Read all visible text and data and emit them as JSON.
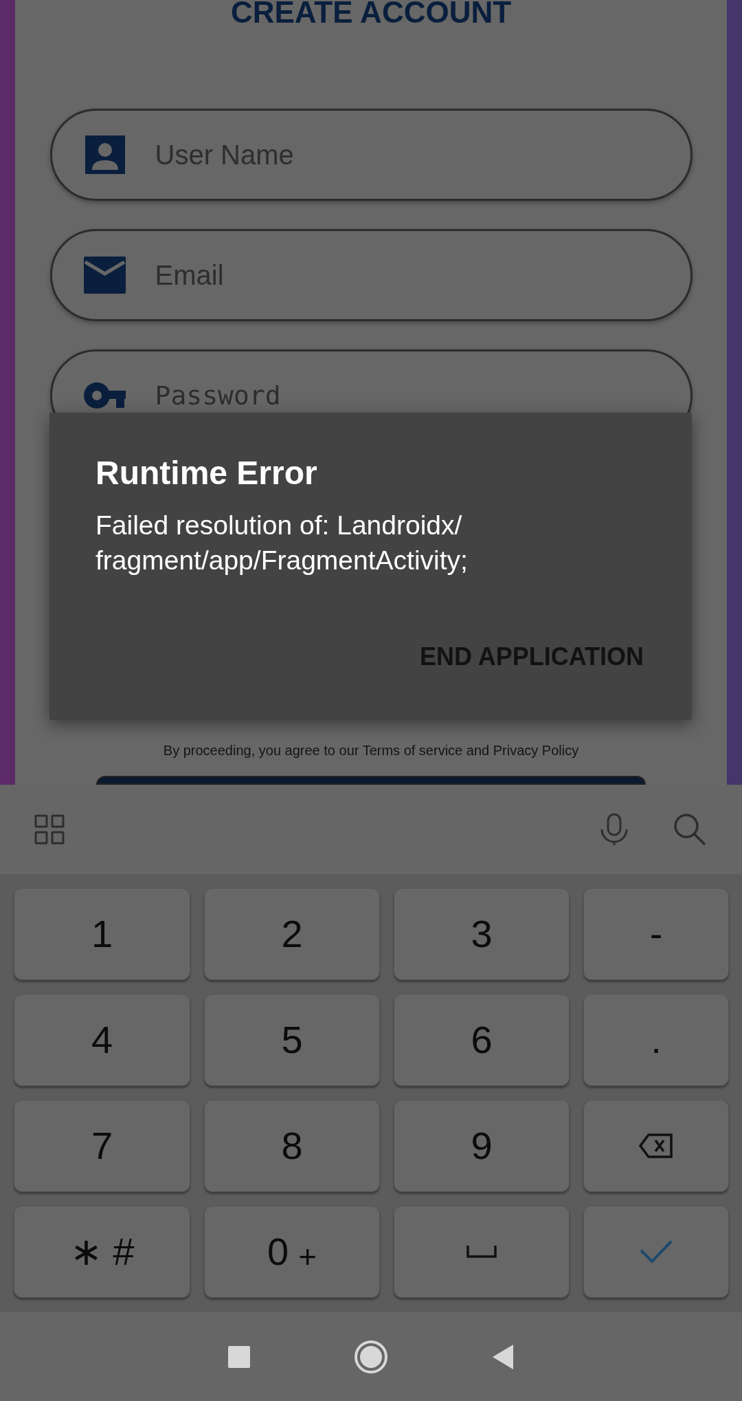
{
  "title": "CREATE ACCOUNT",
  "fields": [
    {
      "kind": "user",
      "placeholder": "User Name"
    },
    {
      "kind": "email",
      "placeholder": "Email"
    },
    {
      "kind": "password",
      "placeholder": "Password"
    }
  ],
  "dialog": {
    "title": "Runtime Error",
    "message_lines": [
      "Failed resolution of: Landroidx/",
      "fragment/app/FragmentActivity;"
    ],
    "button": "END APPLICATION"
  },
  "terms": "By proceeding, you agree to our Terms of service and Privacy Policy",
  "keys": [
    {
      "kind": "char",
      "label": "1"
    },
    {
      "kind": "char",
      "label": "2"
    },
    {
      "kind": "char",
      "label": "3"
    },
    {
      "kind": "char",
      "label": "-"
    },
    {
      "kind": "char",
      "label": "4"
    },
    {
      "kind": "char",
      "label": "5"
    },
    {
      "kind": "char",
      "label": "6"
    },
    {
      "kind": "char",
      "label": "."
    },
    {
      "kind": "char",
      "label": "7"
    },
    {
      "kind": "char",
      "label": "8"
    },
    {
      "kind": "char",
      "label": "9"
    },
    {
      "kind": "backspace"
    },
    {
      "kind": "char",
      "label": "∗ #"
    },
    {
      "kind": "zero",
      "label": "0",
      "sub": "+"
    },
    {
      "kind": "space"
    },
    {
      "kind": "enter"
    }
  ]
}
